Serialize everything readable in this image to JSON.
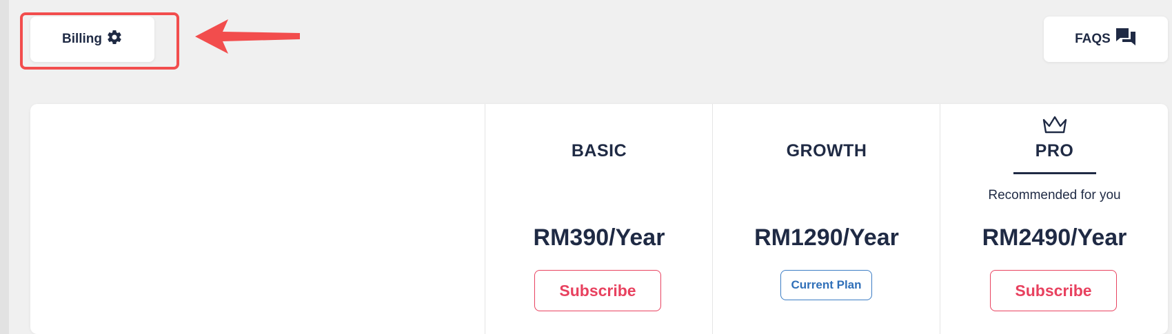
{
  "header": {
    "billing_label": "Billing",
    "billing_icon": "gear-icon",
    "faqs_label": "FAQS",
    "faqs_icon": "chat-bubbles-icon"
  },
  "annotation": {
    "highlight_color": "#f24d4d",
    "arrow_color": "#f24d4d"
  },
  "plans": [
    {
      "name": "BASIC",
      "price": "RM390/Year",
      "action_label": "Subscribe",
      "current": false
    },
    {
      "name": "GROWTH",
      "price": "RM1290/Year",
      "action_label": "Current Plan",
      "current": true
    },
    {
      "name": "PRO",
      "price": "RM2490/Year",
      "action_label": "Subscribe",
      "current": false,
      "badge_icon": "crown-icon",
      "tagline": "Recommended for you"
    }
  ],
  "colors": {
    "text": "#1f2a44",
    "accent": "#e8415f",
    "current_plan": "#2f6fb8",
    "background": "#f0f0f0"
  }
}
